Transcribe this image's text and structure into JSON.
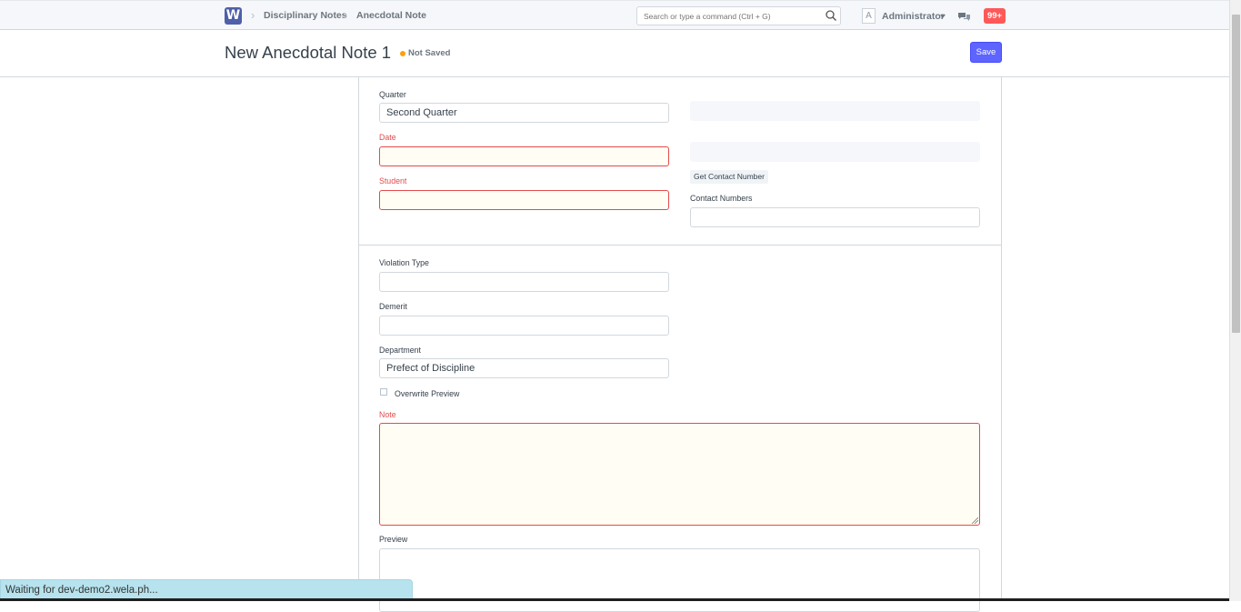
{
  "topbar": {
    "logo": "W",
    "breadcrumbs": [
      "Disciplinary Notes",
      "Anecdotal Note"
    ],
    "search_placeholder": "Search or type a command (Ctrl + G)",
    "avatar_letter": "A",
    "user_name": "Administrator",
    "notification_count": "99+"
  },
  "page": {
    "title": "New Anecdotal Note 1",
    "status": "Not Saved",
    "save_label": "Save"
  },
  "form": {
    "quarter_label": "Quarter",
    "quarter_value": "Second Quarter",
    "date_label": "Date",
    "date_value": "",
    "student_label": "Student",
    "student_value": "",
    "get_contact_label": "Get Contact Number",
    "contact_numbers_label": "Contact Numbers",
    "contact_numbers_value": "",
    "violation_type_label": "Violation Type",
    "violation_type_value": "",
    "demerit_label": "Demerit",
    "demerit_value": "",
    "department_label": "Department",
    "department_value": "Prefect of Discipline",
    "overwrite_preview_label": "Overwrite Preview",
    "overwrite_preview_checked": false,
    "note_label": "Note",
    "preview_label": "Preview"
  },
  "browser_status": "Waiting for dev-demo2.wela.ph...",
  "colors": {
    "primary": "#5e64ff",
    "error": "#e24c4c",
    "indicator": "#ffa00a",
    "notification": "#ff5858"
  }
}
